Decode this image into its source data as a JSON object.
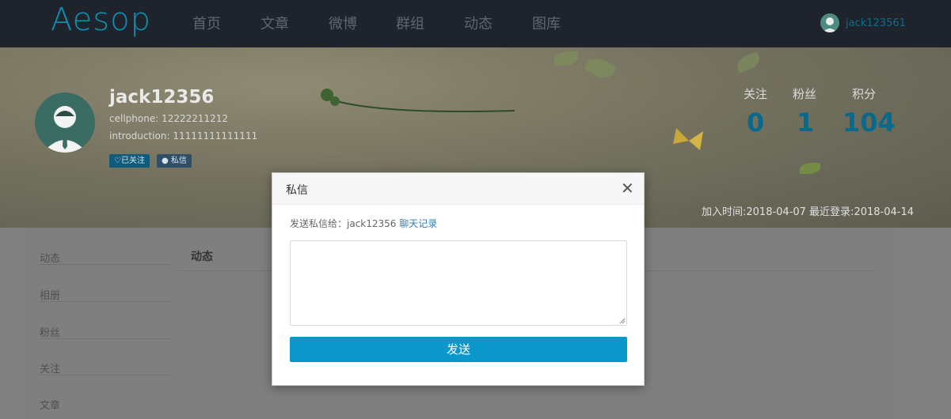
{
  "navbar": {
    "logo": "Aesop",
    "items": [
      "首页",
      "文章",
      "微博",
      "群组",
      "动态",
      "图库"
    ],
    "user": "jack123561"
  },
  "profile": {
    "username": "jack12356",
    "cellphone": "cellphone: 12222211212",
    "introduction": "introduction: 11111111111111",
    "follow_label": "♡已关注",
    "message_label": "私信",
    "stats": [
      {
        "label": "关注",
        "value": "0"
      },
      {
        "label": "粉丝",
        "value": "1"
      },
      {
        "label": "积分",
        "value": "104"
      }
    ],
    "joined": "加入时间:2018-04-07 最近登录:2018-04-14"
  },
  "sidebar": {
    "items": [
      "动态",
      "相册",
      "粉丝",
      "关注",
      "文章"
    ]
  },
  "main": {
    "section_title": "动态"
  },
  "modal": {
    "title": "私信",
    "send_to_label": "发送私信给：jack12356",
    "chat_history": "聊天记录",
    "message_value": "",
    "send_label": "发送"
  },
  "colors": {
    "navbar_bg": "#1f242c",
    "accent": "#0b97c9",
    "stat_value": "#07698c"
  }
}
